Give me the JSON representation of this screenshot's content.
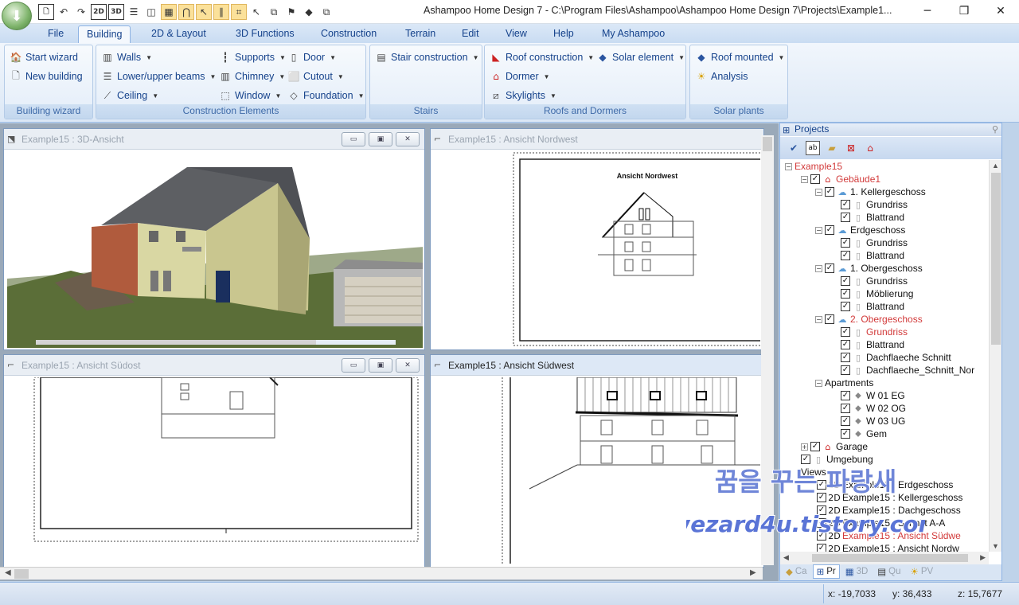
{
  "app": {
    "title": "Ashampoo Home Design 7 - C:\\Program Files\\Ashampoo\\Ashampoo Home Design 7\\Projects\\Example1...",
    "window_buttons": [
      "minimize",
      "restore",
      "close"
    ]
  },
  "quick_access": [
    {
      "icon": "new-file-icon",
      "glyph": "🗋"
    },
    {
      "icon": "undo-icon",
      "glyph": "↶"
    },
    {
      "icon": "redo-icon",
      "glyph": "↷"
    },
    {
      "icon": "view-2d-icon",
      "glyph": "2D"
    },
    {
      "icon": "view-3d-icon",
      "glyph": "3D"
    },
    {
      "icon": "split-horizontal-icon",
      "glyph": "☰"
    },
    {
      "icon": "split-vertical-icon",
      "glyph": "◫"
    },
    {
      "icon": "grid-icon",
      "glyph": "▦",
      "highlight": true
    },
    {
      "icon": "magnet-icon",
      "glyph": "⋂",
      "highlight": true
    },
    {
      "icon": "select-pointer-icon",
      "glyph": "↖",
      "highlight": true
    },
    {
      "icon": "parallel-lines-icon",
      "glyph": "∥",
      "highlight": true
    },
    {
      "icon": "snap-lines-icon",
      "glyph": "⌗",
      "highlight": true
    },
    {
      "icon": "pointer-icon",
      "glyph": "↖"
    },
    {
      "icon": "window-arrow-icon",
      "glyph": "⧉"
    },
    {
      "icon": "flag-icon",
      "glyph": "⚑"
    },
    {
      "icon": "layers-icon",
      "glyph": "◆"
    },
    {
      "icon": "copy-icon",
      "glyph": "⧉"
    }
  ],
  "tabs": [
    "File",
    "Building",
    "2D & Layout",
    "3D Functions",
    "Construction",
    "Terrain",
    "Edit",
    "View",
    "Help",
    "My Ashampoo"
  ],
  "active_tab": "Building",
  "ribbon": {
    "building_wizard": {
      "caption": "Building wizard",
      "start": "Start wizard",
      "new": "New building"
    },
    "construction_elements": {
      "caption": "Construction Elements",
      "walls": "Walls",
      "beams": "Lower/upper beams",
      "ceiling": "Ceiling",
      "supports": "Supports",
      "chimney": "Chimney",
      "window": "Window",
      "door": "Door",
      "cutout": "Cutout",
      "foundation": "Foundation"
    },
    "stairs": {
      "caption": "Stairs",
      "stair": "Stair construction"
    },
    "roofs": {
      "caption": "Roofs and Dormers",
      "roof": "Roof construction",
      "dormer": "Dormer",
      "skylights": "Skylights",
      "solar": "Solar element"
    },
    "solar_plants": {
      "caption": "Solar plants",
      "roof_mounted": "Roof mounted",
      "analysis": "Analysis"
    }
  },
  "viewports": {
    "v3d": {
      "title": "Example15 : 3D-Ansicht"
    },
    "vnw": {
      "title": "Example15 : Ansicht Nordwest",
      "drawing_label": "Ansicht Nordwest"
    },
    "vso": {
      "title": "Example15 : Ansicht Südost"
    },
    "vsw": {
      "title": "Example15 : Ansicht Südwest"
    }
  },
  "projects": {
    "header": "Projects",
    "tools": [
      "check-icon",
      "label-icon",
      "folder-icon",
      "delete-icon",
      "house-icon"
    ],
    "tree": {
      "root": "Example15",
      "building": "Gebäude1",
      "floors": [
        {
          "name": "1. Kellergeschoss",
          "items": [
            "Grundriss",
            "Blattrand"
          ]
        },
        {
          "name": "Erdgeschoss",
          "items": [
            "Grundriss",
            "Blattrand"
          ]
        },
        {
          "name": "1. Obergeschoss",
          "items": [
            "Grundriss",
            "Möblierung",
            "Blattrand"
          ]
        },
        {
          "name": "2. Obergeschoss",
          "items": [
            "Grundriss",
            "Blattrand",
            "Dachflaeche Schnitt",
            "Dachflaeche_Schnitt_Nor"
          ]
        }
      ],
      "apartments": {
        "name": "Apartments",
        "items": [
          "W 01 EG",
          "W 02 OG",
          "W 03 UG",
          "Gem"
        ]
      },
      "garage": "Garage",
      "umgebung": "Umgebung",
      "views_label": "Views",
      "views": [
        "Example15 : Erdgeschoss",
        "Example15 : Kellergeschoss",
        "Example15 : Dachgeschoss",
        "Example15 : Schnitt A-A",
        "Example15 : Ansicht Südwe",
        "Example15 : Ansicht Nordw"
      ]
    },
    "bottom_tabs": [
      "Ca",
      "Pr",
      "3D",
      "Qu",
      "PV"
    ],
    "active_bottom_tab": "Pr"
  },
  "status": {
    "x": "x: -19,7033",
    "y": "y: 36,433",
    "z": "z: 15,7677"
  },
  "watermark": {
    "line1": "꿈을 꾸는 파랑새",
    "line2": "wezard4u.tistory.com"
  }
}
